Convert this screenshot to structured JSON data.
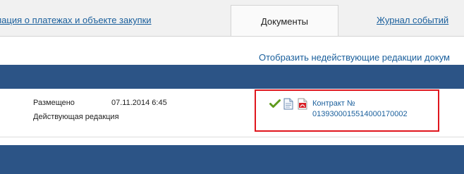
{
  "tabs": {
    "info_label": "рмация о платежах и объекте закупки",
    "documents_label": "Документы",
    "event_log_label": "Журнал событий"
  },
  "actions": {
    "show_inactive_label": "Отобразить недействующие редакции докум"
  },
  "document_row": {
    "status_label": "Размещено",
    "status_date": "07.11.2014 6:45",
    "edition_label": "Действующая редакция",
    "link_line1": "Контракт №",
    "link_line2": "0139300015514000170002",
    "icons": [
      "check-icon",
      "document-icon",
      "pdf-icon"
    ]
  },
  "colors": {
    "band": "#2c5486",
    "link": "#1a5f9c",
    "highlight": "#e0161d"
  }
}
